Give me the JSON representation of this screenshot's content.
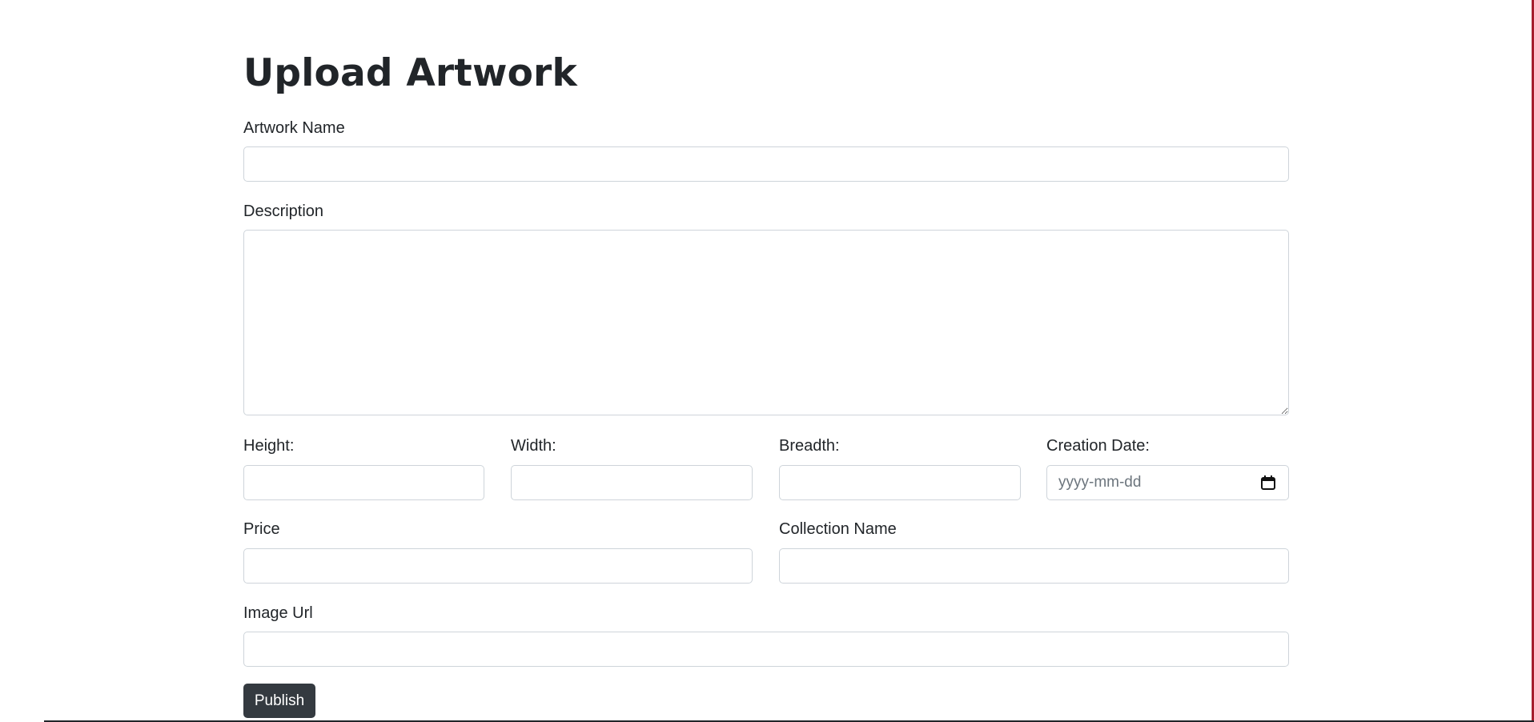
{
  "page": {
    "title": "Upload Artwork"
  },
  "form": {
    "artwork_name": {
      "label": "Artwork Name",
      "value": ""
    },
    "description": {
      "label": "Description",
      "value": ""
    },
    "height": {
      "label": "Height:",
      "value": ""
    },
    "width": {
      "label": "Width:",
      "value": ""
    },
    "breadth": {
      "label": "Breadth:",
      "value": ""
    },
    "creation_date": {
      "label": "Creation Date:",
      "placeholder": "yyyy-mm-dd",
      "icon": "calendar-icon"
    },
    "price": {
      "label": "Price",
      "value": ""
    },
    "collection_name": {
      "label": "Collection Name",
      "value": ""
    },
    "image_url": {
      "label": "Image Url",
      "value": ""
    },
    "submit_label": "Publish"
  },
  "colors": {
    "button_bg": "#343a40",
    "input_border": "#ced4da",
    "right_edge": "#a51d2d"
  }
}
